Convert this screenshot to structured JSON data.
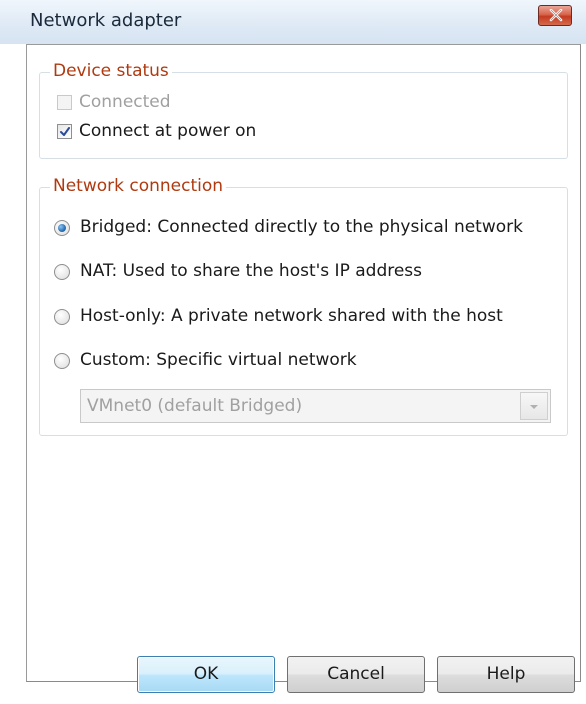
{
  "window": {
    "title": "Network adapter",
    "close_icon": "close-icon"
  },
  "device_status": {
    "legend": "Device status",
    "connected": {
      "label": "Connected",
      "checked": false,
      "enabled": false
    },
    "connect_at_power_on": {
      "label": "Connect at power on",
      "checked": true,
      "enabled": true
    }
  },
  "network_connection": {
    "legend": "Network connection",
    "options": [
      {
        "label": "Bridged: Connected directly to the physical network",
        "selected": true
      },
      {
        "label": "NAT: Used to share the host's IP address",
        "selected": false
      },
      {
        "label": "Host-only: A private network shared with the host",
        "selected": false
      },
      {
        "label": "Custom: Specific virtual network",
        "selected": false
      }
    ],
    "custom_network_select": {
      "value": "VMnet0 (default Bridged)",
      "enabled": false
    }
  },
  "buttons": {
    "ok": "OK",
    "cancel": "Cancel",
    "help": "Help"
  },
  "colors": {
    "legend_text": "#b03a10",
    "default_button_border": "#3c7fb1",
    "radio_selected": "#2a6fb5",
    "close_button": "#c43a20"
  }
}
